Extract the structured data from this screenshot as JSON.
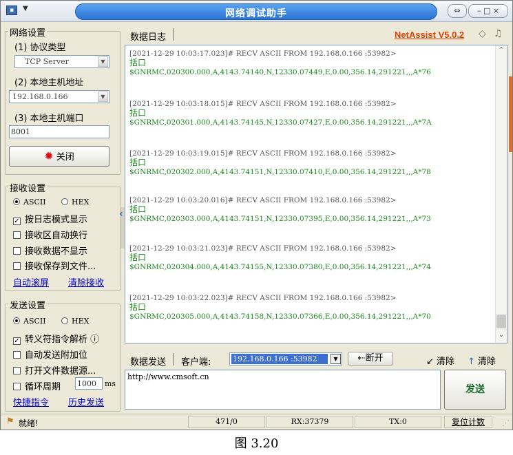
{
  "window": {
    "title": "网络调试助手",
    "pin_btn": "⇔",
    "min_btn": "–",
    "max_btn": "□",
    "close_btn": "×"
  },
  "net_settings": {
    "group_label": "网络设置",
    "protocol_label": "(1) 协议类型",
    "protocol_value": "TCP Server",
    "host_label": "(2) 本地主机地址",
    "host_value": "192.168.0.166",
    "port_label": "(3) 本地主机端口",
    "port_value": "8001",
    "close_button": "关闭"
  },
  "recv_settings": {
    "group_label": "接收设置",
    "ascii": "ASCII",
    "hex": "HEX",
    "options": [
      "按日志模式显示",
      "接收区自动换行",
      "接收数据不显示",
      "接收保存到文件..."
    ],
    "options_checked": [
      true,
      false,
      false,
      false
    ],
    "auto_scroll": "自动滚屏",
    "clear_recv": "清除接收"
  },
  "send_settings": {
    "group_label": "发送设置",
    "ascii": "ASCII",
    "hex": "HEX",
    "options": [
      "转义符指令解析 ⓘ",
      "自动发送附加位",
      "打开文件数据源...",
      "循环周期"
    ],
    "options_checked": [
      true,
      false,
      false,
      false
    ],
    "period_value": "1000",
    "period_unit": "ms",
    "quick_cmd": "快捷指令",
    "history": "历史发送"
  },
  "log": {
    "tab_title": "数据日志",
    "version": "NetAssist V5.0.2",
    "entries": [
      {
        "header": "[2021-12-29 10:03:17.023]# RECV ASCII FROM 192.168.0.166 :53982>",
        "line1": "括口",
        "line2": "$GNRMC,020300.000,A,4143.74140,N,12330.07449,E,0.00,356.14,291221,,,A*76"
      },
      {
        "header": "[2021-12-29 10:03:18.015]# RECV ASCII FROM 192.168.0.166 :53982>",
        "line1": "括口",
        "line2": "$GNRMC,020301.000,A,4143.74145,N,12330.07427,E,0.00,356.14,291221,,,A*7A"
      },
      {
        "header": "[2021-12-29 10:03:19.015]# RECV ASCII FROM 192.168.0.166 :53982>",
        "line1": "括口",
        "line2": "$GNRMC,020302.000,A,4143.74151,N,12330.07410,E,0.00,356.14,291221,,,A*78"
      },
      {
        "header": "[2021-12-29 10:03:20.016]# RECV ASCII FROM 192.168.0.166 :53982>",
        "line1": "括口",
        "line2": "$GNRMC,020303.000,A,4143.74151,N,12330.07395,E,0.00,356.14,291221,,,A*73"
      },
      {
        "header": "[2021-12-29 10:03:21.023]# RECV ASCII FROM 192.168.0.166 :53982>",
        "line1": "括口",
        "line2": "$GNRMC,020304.000,A,4143.74155,N,12330.07380,E,0.00,356.14,291221,,,A*74"
      },
      {
        "header": "[2021-12-29 10:03:22.023]# RECV ASCII FROM 192.168.0.166 :53982>",
        "line1": "括口",
        "line2": "$GNRMC,020305.000,A,4143.74158,N,12330.07366,E,0.00,356.14,291221,,,A*70"
      }
    ]
  },
  "send": {
    "tab_title": "数据发送",
    "client_label": "客户端:",
    "client_value": "192.168.0.166 :53982",
    "disconnect": "断开",
    "clear1": "清除",
    "clear2": "清除",
    "text": "http://www.cmsoft.cn",
    "send_button": "发送"
  },
  "status": {
    "ready": "就绪!",
    "count": "471/0",
    "rx": "RX:37379",
    "tx": "TX:0",
    "reset": "复位计数"
  },
  "caption": "图 3.20"
}
